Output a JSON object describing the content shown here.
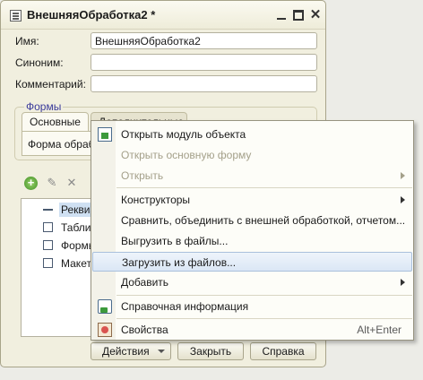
{
  "window": {
    "title": "ВнешняяОбработка2 *",
    "minimize_label": "",
    "close_label": "✕"
  },
  "form": {
    "name_label": "Имя:",
    "name_value": "ВнешняяОбработка2",
    "synonym_label": "Синоним:",
    "synonym_value": "",
    "comment_label": "Комментарий:",
    "comment_value": ""
  },
  "forms_group": {
    "title": "Формы",
    "tabs": [
      {
        "label": "Основные"
      },
      {
        "label": "Дополнительные"
      }
    ],
    "content_label": "Форма обработки:"
  },
  "tree": {
    "items": [
      {
        "label": "Реквизиты"
      },
      {
        "label": "Табличные части"
      },
      {
        "label": "Формы"
      },
      {
        "label": "Макеты"
      }
    ]
  },
  "buttons": {
    "actions": "Действия",
    "close": "Закрыть",
    "help": "Справка"
  },
  "menu": {
    "items": [
      {
        "label": "Открыть модуль объекта",
        "enabled": true,
        "icon": "module-icon"
      },
      {
        "label": "Открыть основную форму",
        "enabled": false
      },
      {
        "label": "Открыть",
        "enabled": false,
        "submenu": true
      },
      {
        "label": "Конструкторы",
        "enabled": true,
        "submenu": true
      },
      {
        "label": "Сравнить, объединить с внешней обработкой, отчетом...",
        "enabled": true
      },
      {
        "label": "Выгрузить в файлы...",
        "enabled": true
      },
      {
        "label": "Загрузить из файлов...",
        "enabled": true,
        "highlighted": true
      },
      {
        "label": "Добавить",
        "enabled": true,
        "submenu": true
      },
      {
        "label": "Справочная информация",
        "enabled": true,
        "icon": "help-icon"
      },
      {
        "label": "Свойства",
        "enabled": true,
        "icon": "properties-icon",
        "shortcut": "Alt+Enter"
      }
    ]
  },
  "colors": {
    "window_bg": "#f1efdf",
    "menu_highlight": "#dbe7f5",
    "group_title": "#3a3a9a",
    "disabled_text": "#a4a08a"
  }
}
